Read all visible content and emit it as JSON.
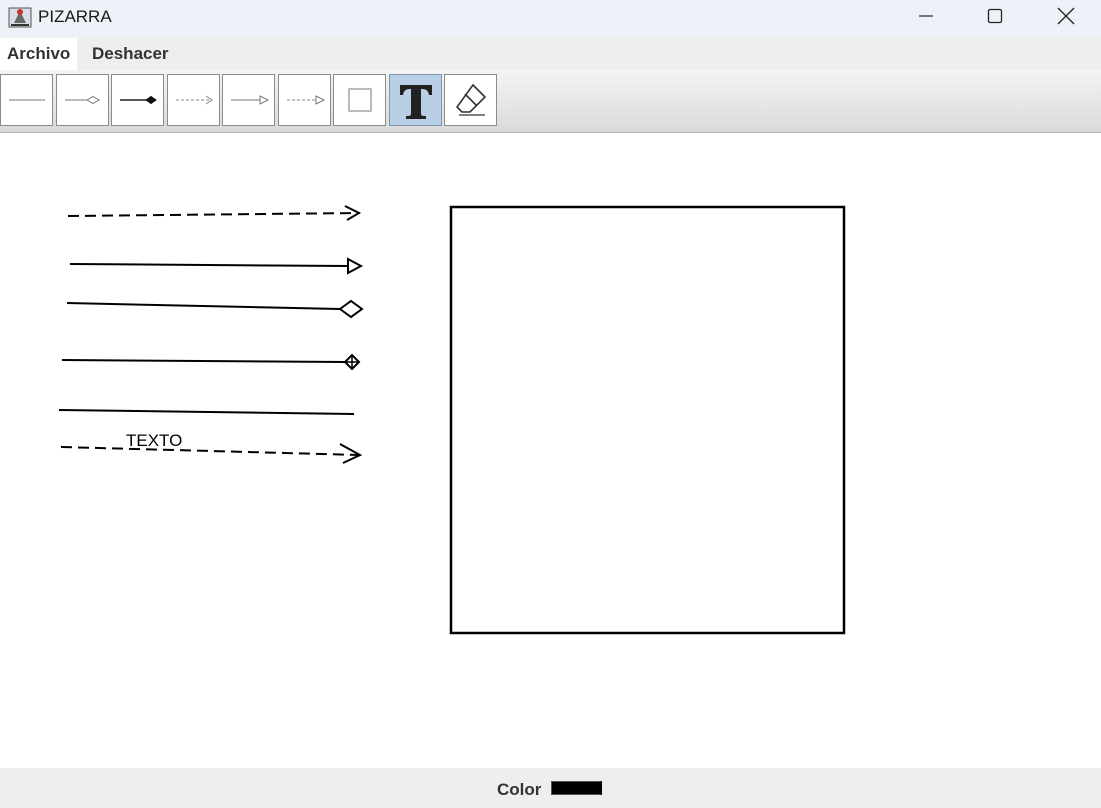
{
  "window": {
    "title": "PIZARRA",
    "controls": [
      "minimize-icon",
      "maximize-icon",
      "close-icon"
    ]
  },
  "menubar": {
    "items": [
      {
        "label": "Archivo"
      },
      {
        "label": "Deshacer"
      }
    ]
  },
  "toolbar": {
    "tools": [
      {
        "name": "line-tool",
        "icon": "plain-line-icon"
      },
      {
        "name": "aggregation-arrow-tool",
        "icon": "hollow-diamond-arrow-icon"
      },
      {
        "name": "composition-arrow-tool",
        "icon": "filled-diamond-arrow-icon"
      },
      {
        "name": "dependency-arrow-tool",
        "icon": "dashed-open-arrow-icon"
      },
      {
        "name": "inheritance-arrow-tool",
        "icon": "hollow-triangle-arrow-icon"
      },
      {
        "name": "realization-arrow-tool",
        "icon": "dashed-triangle-arrow-icon"
      },
      {
        "name": "rectangle-tool",
        "icon": "square-icon"
      },
      {
        "name": "text-tool",
        "icon": "text-t-icon",
        "selected": true
      },
      {
        "name": "eraser-tool",
        "icon": "eraser-icon"
      }
    ]
  },
  "canvas": {
    "text_label": "TEXTO"
  },
  "statusbar": {
    "color_label": "Color",
    "current_color": "#000000"
  }
}
